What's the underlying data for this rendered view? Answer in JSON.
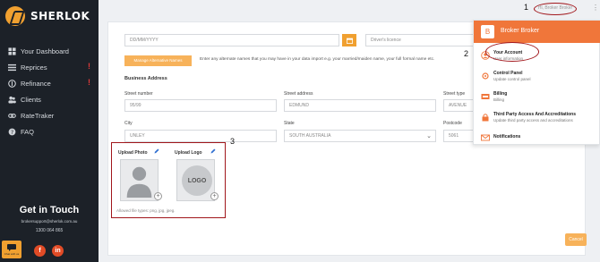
{
  "brand": {
    "name": "SHERLOK",
    "accent": "#f0a030"
  },
  "sidebar": {
    "items": [
      {
        "label": "Your Dashboard",
        "icon": "dashboard-icon",
        "alert": ""
      },
      {
        "label": "Reprices",
        "icon": "list-icon",
        "alert": "!"
      },
      {
        "label": "Refinance",
        "icon": "money-icon",
        "alert": "!"
      },
      {
        "label": "Clients",
        "icon": "users-icon",
        "alert": ""
      },
      {
        "label": "RateTraker",
        "icon": "link-icon",
        "alert": ""
      },
      {
        "label": "FAQ",
        "icon": "question-icon",
        "alert": ""
      }
    ]
  },
  "contact": {
    "title": "Get in Touch",
    "email": "brokersupport@sherlok.com.au",
    "phone": "1300 064 865",
    "chat_label": "Chat with us",
    "facebook_label": "f",
    "linkedin_label": "in"
  },
  "form": {
    "date_placeholder": "DD/MM/YYYY",
    "licence_placeholder": "Driver's licence",
    "alt_names_button": "Manage Alternative Names",
    "alt_names_note": "Enter any alternate names that you may have in your data import e.g. your married/maiden name, your full formal name etc.",
    "business_address_title": "Business Address",
    "street_number_label": "Street number",
    "street_number_value": "95/99",
    "street_address_label": "Street address",
    "street_address_value": "EDMUND",
    "street_type_label": "Street type",
    "street_type_value": "AVENUE",
    "city_label": "City",
    "city_value": "UNLEY",
    "state_label": "State",
    "state_value": "SOUTH AUSTRALIA",
    "postcode_label": "Postcode",
    "postcode_value": "5061",
    "upload_photo_label": "Upload Photo",
    "upload_logo_label": "Upload Logo",
    "logo_placeholder": "LOGO",
    "allowed_types": "Allowed file types: png, jpg, jpeg.",
    "cancel_label": "Cancel"
  },
  "header": {
    "user_chip": "Hi, Broker Broker",
    "menu_dots": "⋮"
  },
  "dropdown": {
    "avatar_letter": "B",
    "user_name": "Broker Broker",
    "items": [
      {
        "title": "Your Account",
        "sub": "User information",
        "icon": "user-account-icon"
      },
      {
        "title": "Control Panel",
        "sub": "Update control panel",
        "icon": "control-panel-icon"
      },
      {
        "title": "Billing",
        "sub": "Billing",
        "icon": "billing-icon"
      },
      {
        "title": "Third Party Access And Accreditations",
        "sub": "Update third party access and accreditations",
        "icon": "lock-icon"
      },
      {
        "title": "Notifications",
        "sub": "",
        "icon": "mail-icon"
      }
    ]
  },
  "annotations": {
    "one": "1",
    "two": "2",
    "three": "3"
  }
}
